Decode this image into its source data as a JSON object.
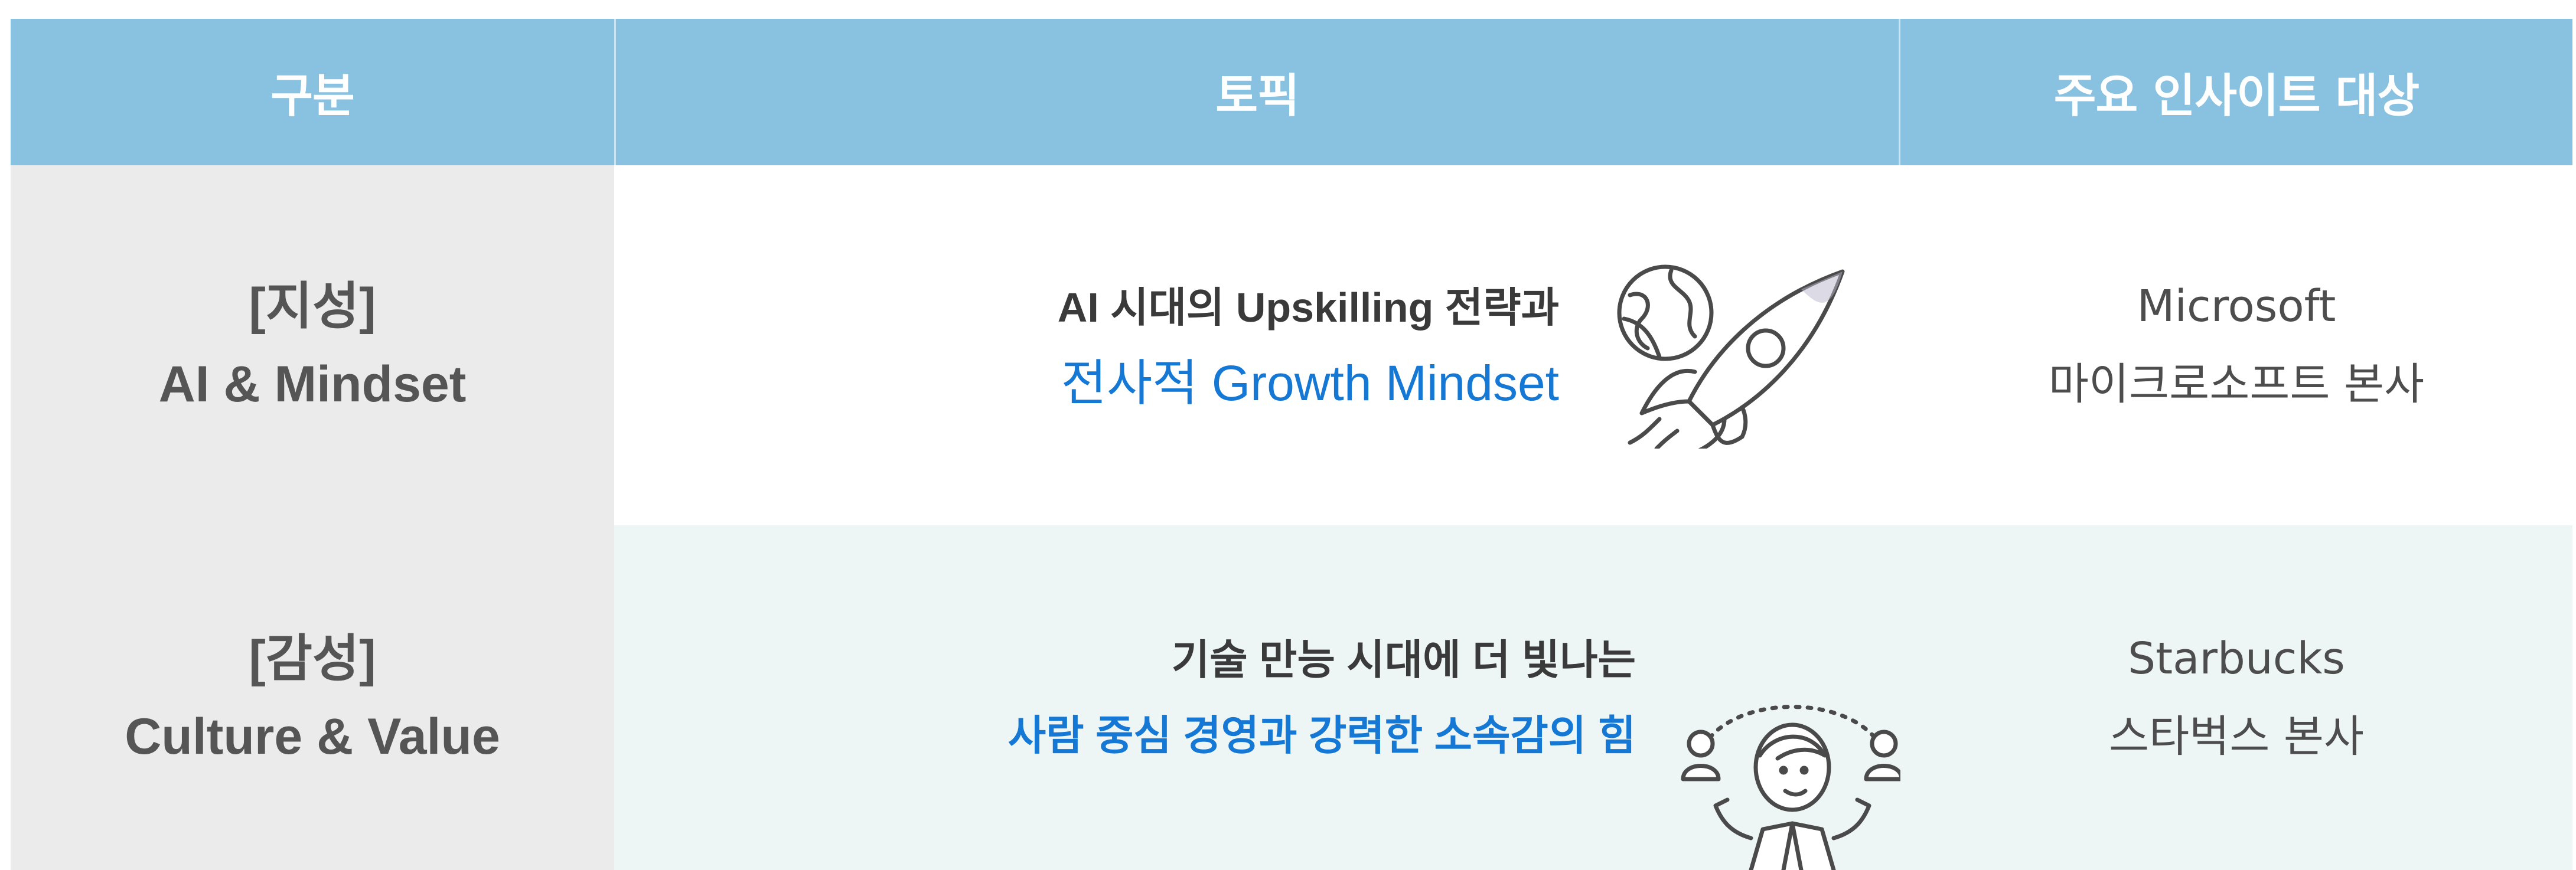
{
  "header": {
    "col1": "구분",
    "col2": "토픽",
    "col3": "주요 인사이트 대상"
  },
  "rows": [
    {
      "category_line1": "[지성]",
      "category_line2": "AI & Mindset",
      "topic_line1": "AI 시대의 Upskilling 전략과",
      "topic_line2": "전사적 Growth Mindset",
      "insight_line1": "Microsoft",
      "insight_line2": "마이크로소프트 본사",
      "illustration_icon": "rocket-icon"
    },
    {
      "category_line1": "[감성]",
      "category_line2": "Culture & Value",
      "topic_line1": "기술 만능 시대에 더 빛나는",
      "topic_line2": "사람 중심 경영과 강력한 소속감의 힘",
      "insight_line1": "Starbucks",
      "insight_line2": "스타벅스 본사",
      "illustration_icon": "leader-with-people-icon"
    }
  ],
  "colors": {
    "header_bg": "#89c1e0",
    "category_bg": "#ebebeb",
    "row2_bg": "#eef5f5",
    "accent_blue": "#1478d4",
    "text_dark": "#3a3a3a"
  }
}
